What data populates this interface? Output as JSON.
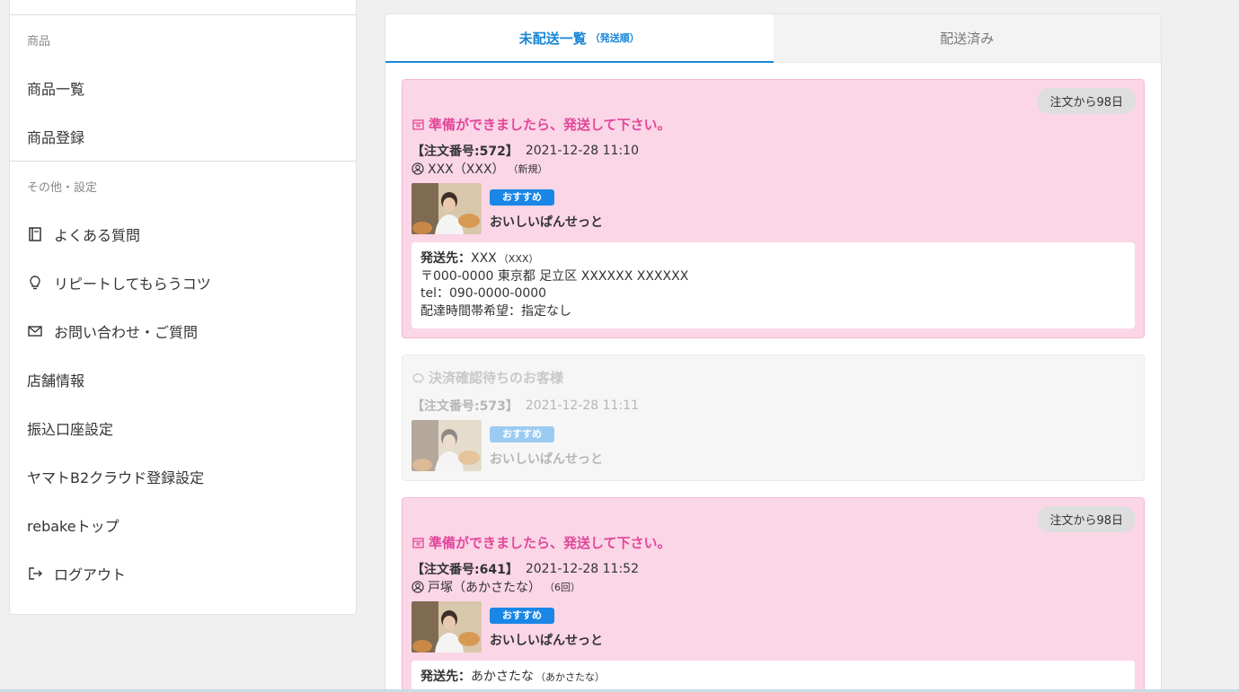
{
  "sidebar": {
    "section_products": "商品",
    "product_list": "商品一覧",
    "product_register": "商品登録",
    "section_other": "その他・設定",
    "faq": "よくある質問",
    "repeat_tips": "リピートしてもらうコツ",
    "contact": "お問い合わせ・ご質問",
    "store_info": "店舗情報",
    "bank_settings": "振込口座設定",
    "yamato_settings": "ヤマトB2クラウド登録設定",
    "rebake_top": "rebakeトップ",
    "logout": "ログアウト"
  },
  "tabs": {
    "active_label": "未配送一覧",
    "active_sub": "（発送順）",
    "inactive_label": "配送済み"
  },
  "orders": [
    {
      "days": "注文から98日",
      "status": "準備ができましたら、発送して下さい。",
      "order_number": "【注文番号:572】",
      "datetime": "2021-12-28 11:10",
      "customer": "XXX（XXX）",
      "customer_tag": "（新規）",
      "badge": "おすすめ",
      "product": "おいしいぱんせっと",
      "ship_label": "発送先：",
      "ship_name": "XXX",
      "ship_kana": "（XXX）",
      "address": "〒000-0000 東京都 足立区 XXXXXX XXXXXX",
      "tel": "tel：090-0000-0000",
      "delivery_time": "配達時間帯希望：指定なし"
    },
    {
      "status": "決済確認待ちのお客様",
      "order_number": "【注文番号:573】",
      "datetime": "2021-12-28 11:11",
      "badge": "おすすめ",
      "product": "おいしいぱんせっと"
    },
    {
      "days": "注文から98日",
      "status": "準備ができましたら、発送して下さい。",
      "order_number": "【注文番号:641】",
      "datetime": "2021-12-28 11:52",
      "customer": "戸塚（あかさたな）",
      "customer_tag": "（6回）",
      "badge": "おすすめ",
      "product": "おいしいぱんせっと",
      "ship_label": "発送先：",
      "ship_name": "あかさたな",
      "ship_kana": "（あかさたな）"
    }
  ],
  "colors": {
    "accent": "#1a87d6",
    "pink_card": "#fbd6e6",
    "status_pink": "#e2479a"
  }
}
